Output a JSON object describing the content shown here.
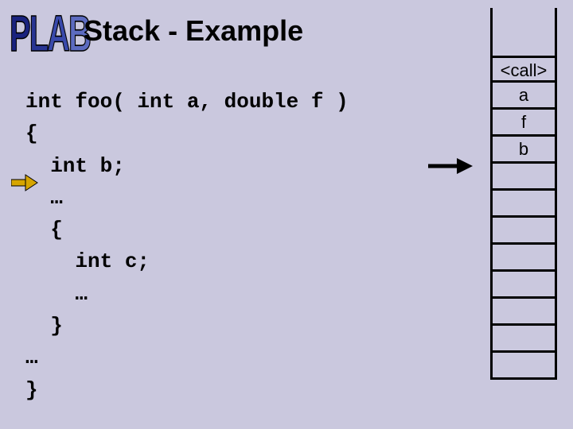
{
  "logo": {
    "p": "P",
    "l": "L",
    "a": "A",
    "b": "B"
  },
  "title": "Stack - Example",
  "code": {
    "l1": "int foo( int a, double f )",
    "l2": "{",
    "l3": "  int b;",
    "l4": "  …",
    "l5": "  {",
    "l6": "    int c;",
    "l7": "    …",
    "l8": "  }",
    "l9": "…",
    "l10": "}"
  },
  "stack": {
    "cells": [
      "<call>",
      "a",
      "f",
      "b",
      "",
      "",
      "",
      "",
      "",
      "",
      "",
      ""
    ]
  }
}
